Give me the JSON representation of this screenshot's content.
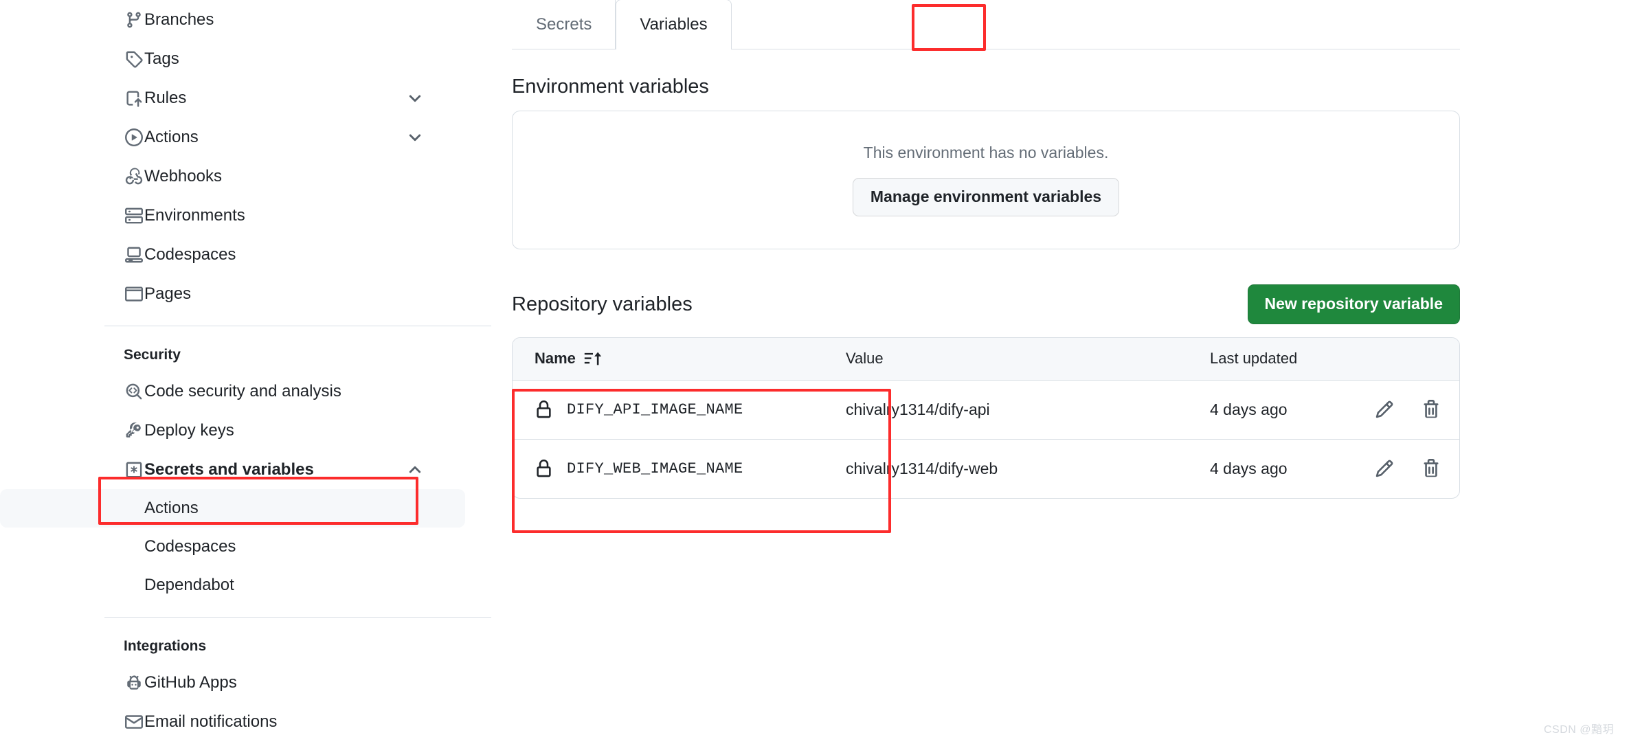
{
  "sidebar": {
    "groups": [
      {
        "label": null,
        "items": [
          {
            "label": "Branches",
            "icon": "git-branch-icon",
            "chevron": null,
            "active": false,
            "sub": false
          },
          {
            "label": "Tags",
            "icon": "tag-icon",
            "chevron": null,
            "active": false,
            "sub": false
          },
          {
            "label": "Rules",
            "icon": "rules-icon",
            "chevron": "chevron-down-icon",
            "active": false,
            "sub": false
          },
          {
            "label": "Actions",
            "icon": "play-circle-icon",
            "chevron": "chevron-down-icon",
            "active": false,
            "sub": false
          },
          {
            "label": "Webhooks",
            "icon": "webhook-icon",
            "chevron": null,
            "active": false,
            "sub": false
          },
          {
            "label": "Environments",
            "icon": "server-icon",
            "chevron": null,
            "active": false,
            "sub": false
          },
          {
            "label": "Codespaces",
            "icon": "codespaces-icon",
            "chevron": null,
            "active": false,
            "sub": false
          },
          {
            "label": "Pages",
            "icon": "browser-icon",
            "chevron": null,
            "active": false,
            "sub": false
          }
        ]
      },
      {
        "label": "Security",
        "items": [
          {
            "label": "Code security and analysis",
            "icon": "code-scan-icon",
            "chevron": null,
            "active": false,
            "sub": false
          },
          {
            "label": "Deploy keys",
            "icon": "key-icon",
            "chevron": null,
            "active": false,
            "sub": false
          },
          {
            "label": "Secrets and variables",
            "icon": "asterisk-box-icon",
            "chevron": "chevron-up-icon",
            "active": false,
            "sub": false,
            "bold": true
          },
          {
            "label": "Actions",
            "icon": null,
            "chevron": null,
            "active": true,
            "sub": true
          },
          {
            "label": "Codespaces",
            "icon": null,
            "chevron": null,
            "active": false,
            "sub": true
          },
          {
            "label": "Dependabot",
            "icon": null,
            "chevron": null,
            "active": false,
            "sub": true
          }
        ]
      },
      {
        "label": "Integrations",
        "items": [
          {
            "label": "GitHub Apps",
            "icon": "github-apps-icon",
            "chevron": null,
            "active": false,
            "sub": false
          },
          {
            "label": "Email notifications",
            "icon": "mail-icon",
            "chevron": null,
            "active": false,
            "sub": false
          }
        ]
      }
    ]
  },
  "tabs": [
    {
      "label": "Secrets",
      "active": false
    },
    {
      "label": "Variables",
      "active": true
    }
  ],
  "environment": {
    "heading": "Environment variables",
    "empty_text": "This environment has no variables.",
    "manage_button": "Manage environment variables"
  },
  "repository": {
    "heading": "Repository variables",
    "new_button": "New repository variable",
    "columns": {
      "name": "Name",
      "value": "Value",
      "last_updated": "Last updated",
      "sort_icon": "sort-ascending-icon"
    },
    "rows": [
      {
        "name": "DIFY_API_IMAGE_NAME",
        "value": "chivalry1314/dify-api",
        "last_updated": "4 days ago",
        "lock_icon": "lock-icon",
        "edit_icon": "pencil-icon",
        "delete_icon": "trash-icon"
      },
      {
        "name": "DIFY_WEB_IMAGE_NAME",
        "value": "chivalry1314/dify-web",
        "last_updated": "4 days ago",
        "lock_icon": "lock-icon",
        "edit_icon": "pencil-icon",
        "delete_icon": "trash-icon"
      }
    ]
  },
  "annotations": {
    "color": "#fc2c2c",
    "boxes": [
      "variables-tab",
      "sidebar-actions-item",
      "repository-variables-rows"
    ]
  },
  "watermark": "CSDN @黯玥",
  "colors": {
    "accent_green": "#1f883d",
    "accent_blue": "#0969da",
    "annotation_red": "#fc2c2c",
    "border": "#d8dee4",
    "surface": "#f6f8fa",
    "text": "#1f2328",
    "muted_text": "#636c76"
  }
}
